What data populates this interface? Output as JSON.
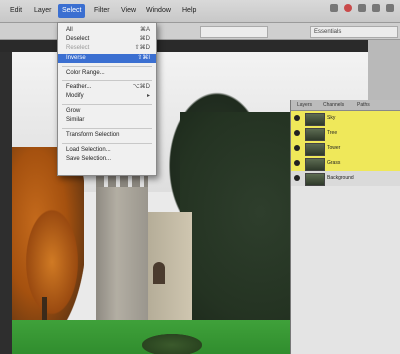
{
  "menubar": {
    "items": [
      {
        "label": "Edit"
      },
      {
        "label": "Layer"
      },
      {
        "label": "Select",
        "active": true
      },
      {
        "label": "Filter"
      },
      {
        "label": "View"
      },
      {
        "label": "Window"
      },
      {
        "label": "Help"
      }
    ]
  },
  "options": {
    "field1": "",
    "field2": "Essentials"
  },
  "select_menu": {
    "items": [
      {
        "label": "All",
        "shortcut": "⌘A"
      },
      {
        "label": "Deselect",
        "shortcut": "⌘D"
      },
      {
        "label": "Reselect",
        "shortcut": "⇧⌘D",
        "dim": true
      },
      {
        "label": "Inverse",
        "shortcut": "⇧⌘I",
        "highlight": true
      },
      {
        "label": "Color Range..."
      },
      {
        "label": "Feather...",
        "shortcut": "⌥⌘D"
      },
      {
        "label": "Modify",
        "shortcut": "▸"
      },
      {
        "label": "Grow"
      },
      {
        "label": "Similar"
      },
      {
        "label": "Transform Selection"
      },
      {
        "label": "Load Selection..."
      },
      {
        "label": "Save Selection..."
      }
    ]
  },
  "layers_panel": {
    "tabs": [
      "Layers",
      "Channels",
      "Paths"
    ],
    "layers": [
      {
        "name": "Sky",
        "highlight": true
      },
      {
        "name": "Tree",
        "highlight": true
      },
      {
        "name": "Tower",
        "highlight": true
      },
      {
        "name": "Grass",
        "highlight": true
      },
      {
        "name": "Background",
        "highlight": false
      }
    ]
  },
  "colors": {
    "menu_highlight": "#3b6fd1",
    "layer_highlight": "#efe85a"
  }
}
